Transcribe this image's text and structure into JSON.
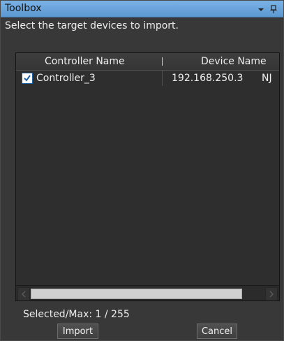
{
  "panel": {
    "title": "Toolbox",
    "instruction": "Select the target devices to import."
  },
  "table": {
    "columns": [
      "Controller Name",
      "Device Name"
    ],
    "rows": [
      {
        "checked": true,
        "controller_name": "Controller_3",
        "device_name": "192.168.250.3",
        "extra": "NJ"
      }
    ]
  },
  "selection": {
    "summary": "Selected/Max: 1 / 255"
  },
  "buttons": {
    "import": "Import",
    "cancel": "Cancel"
  },
  "colors": {
    "titlebar": "#6aa6de",
    "background": "#383838",
    "checkbox_border": "#1d5fa3",
    "checkmark": "#1d5fa3"
  },
  "icons": [
    "dropdown-icon",
    "pin-icon",
    "checkmark-icon",
    "scroll-left-icon",
    "scroll-right-icon"
  ]
}
